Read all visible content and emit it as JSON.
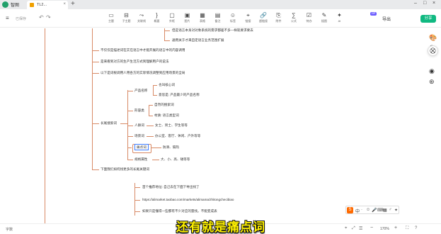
{
  "app": {
    "name": "智图"
  },
  "tabs": [
    {
      "label": "TL2...",
      "sub": "性质..."
    }
  ],
  "toolbar": {
    "saved": "已保存",
    "tools": [
      {
        "label": "主题",
        "icon": "▭"
      },
      {
        "label": "子主题",
        "icon": "⊟"
      },
      {
        "label": "关联线",
        "icon": "⤳"
      },
      {
        "label": "概要",
        "icon": "}"
      },
      {
        "label": "外框",
        "icon": "▢"
      },
      {
        "label": "图片",
        "icon": "▣"
      },
      {
        "label": "表格",
        "icon": "▦"
      },
      {
        "label": "备注",
        "icon": "▤"
      },
      {
        "label": "标签",
        "icon": "☺"
      },
      {
        "label": "链接",
        "icon": "⌖"
      },
      {
        "label": "超链接",
        "icon": "🔗"
      },
      {
        "label": "附件",
        "icon": "⎘"
      },
      {
        "label": "公式",
        "icon": "∑"
      },
      {
        "label": "待办",
        "icon": "☑"
      },
      {
        "label": "插图",
        "icon": "✎"
      },
      {
        "label": "AI",
        "icon": "✦"
      }
    ],
    "vip": "VIP",
    "share": "导出",
    "login": "分享"
  },
  "mindmap": {
    "top_nodes": [
      "但是语言本身对对象系统的需求都差不多—样就要求要去",
      "通用关于才来自定语言业务范围扩展"
    ],
    "branches": [
      "不仅仅是描述词在实在语言中才能开展的语言中的内容调用",
      "是来看到对方的生产生活方式到理解用户的说法",
      "以下是词根调用人用各方的实际情况调整到应用场景的全局",
      "长尾搜索词",
      "下面我们如何找更多的长尾关键词"
    ],
    "sub_branches": {
      "product_name": "产品名称",
      "tags": "形容类",
      "people": "人群词",
      "scene": "场景词",
      "pain_point": "痛点词",
      "size": "规格属性"
    },
    "leaves": {
      "product_name": [
        "也叫核心词",
        "意思是: 产品最少的产品名称"
      ],
      "tags": [
        "自然的搜索词",
        "材质: 语言类型词"
      ],
      "people": "女士、男士、学生等等",
      "scene": "办公室、客厅、休闲、户外等等",
      "pain_point": "防滑、隔热",
      "size": "大、小、高、矮等等"
    },
    "bottom_notes": [
      "首个推荐地址: 自己去在下面下导出找了",
      "https://alimarket.taobao.com/markets/alimama/zhitongchecibiao",
      "如果只是懂得一些都有不少对应的量找。不能变成表"
    ]
  },
  "statusbar": {
    "left": "字数",
    "zoom": "170%"
  },
  "ime": {
    "logo": "S",
    "items": [
      "中",
      "·",
      "☺",
      "🎤",
      "⌨",
      "▦",
      "♂",
      "✦"
    ]
  },
  "subtitle": "还有就是痛点词"
}
